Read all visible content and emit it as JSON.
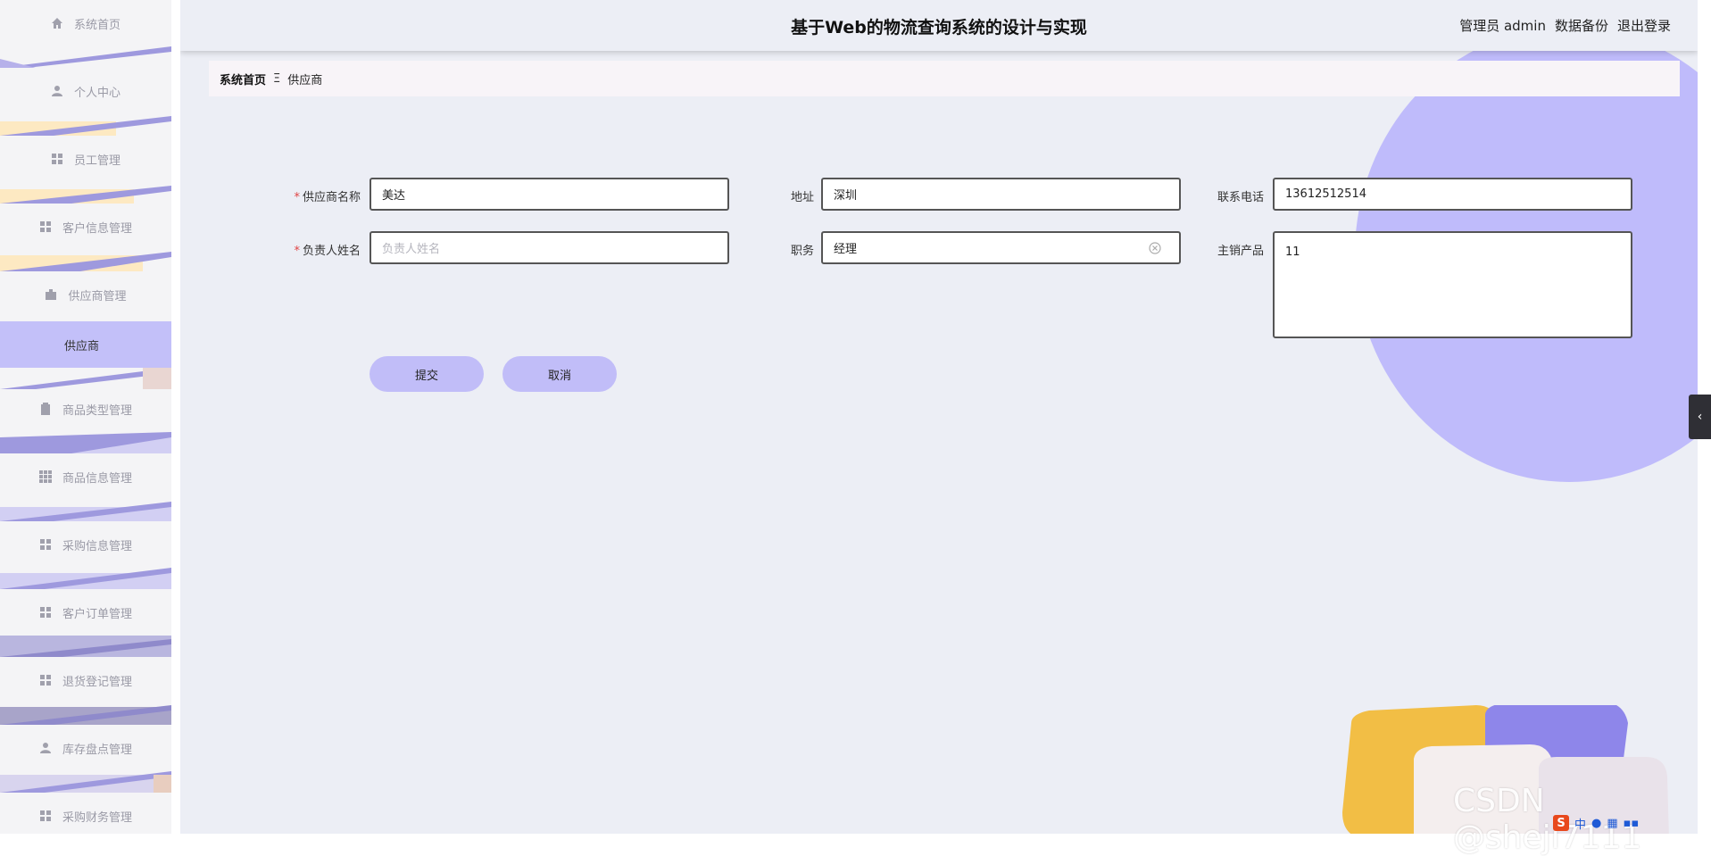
{
  "sidebar": {
    "items": [
      {
        "label": "系统首页",
        "icon": "home-icon"
      },
      {
        "label": "个人中心",
        "icon": "user-icon"
      },
      {
        "label": "员工管理",
        "icon": "grid-icon"
      },
      {
        "label": "客户信息管理",
        "icon": "grid-icon"
      },
      {
        "label": "供应商管理",
        "icon": "briefcase-icon"
      },
      {
        "label": "供应商",
        "icon": ""
      },
      {
        "label": "商品类型管理",
        "icon": "clipboard-icon"
      },
      {
        "label": "商品信息管理",
        "icon": "grid9-icon"
      },
      {
        "label": "采购信息管理",
        "icon": "grid-icon"
      },
      {
        "label": "客户订单管理",
        "icon": "grid-icon"
      },
      {
        "label": "退货登记管理",
        "icon": "grid-icon"
      },
      {
        "label": "库存盘点管理",
        "icon": "user-icon"
      },
      {
        "label": "采购财务管理",
        "icon": "grid-icon"
      }
    ]
  },
  "header": {
    "title": "基于Web的物流查询系统的设计与实现",
    "user": "管理员 admin",
    "backup": "数据备份",
    "logout": "退出登录"
  },
  "breadcrumb": {
    "home": "系统首页",
    "sep": "Ξ",
    "current": "供应商"
  },
  "form": {
    "supplier_name": {
      "label": "供应商名称",
      "value": "美达"
    },
    "address": {
      "label": "地址",
      "value": "深圳"
    },
    "phone": {
      "label": "联系电话",
      "value": "13612512514"
    },
    "contact_name": {
      "label": "负责人姓名",
      "placeholder": "负责人姓名"
    },
    "position": {
      "label": "职务",
      "value": "经理"
    },
    "products": {
      "label": "主销产品",
      "value": "11"
    },
    "required_mark": "*",
    "submit": "提交",
    "cancel": "取消"
  },
  "collapse_arrow": "‹",
  "watermark": "CSDN @sheji7111",
  "tray": {
    "ime": "S",
    "lang": "中"
  }
}
